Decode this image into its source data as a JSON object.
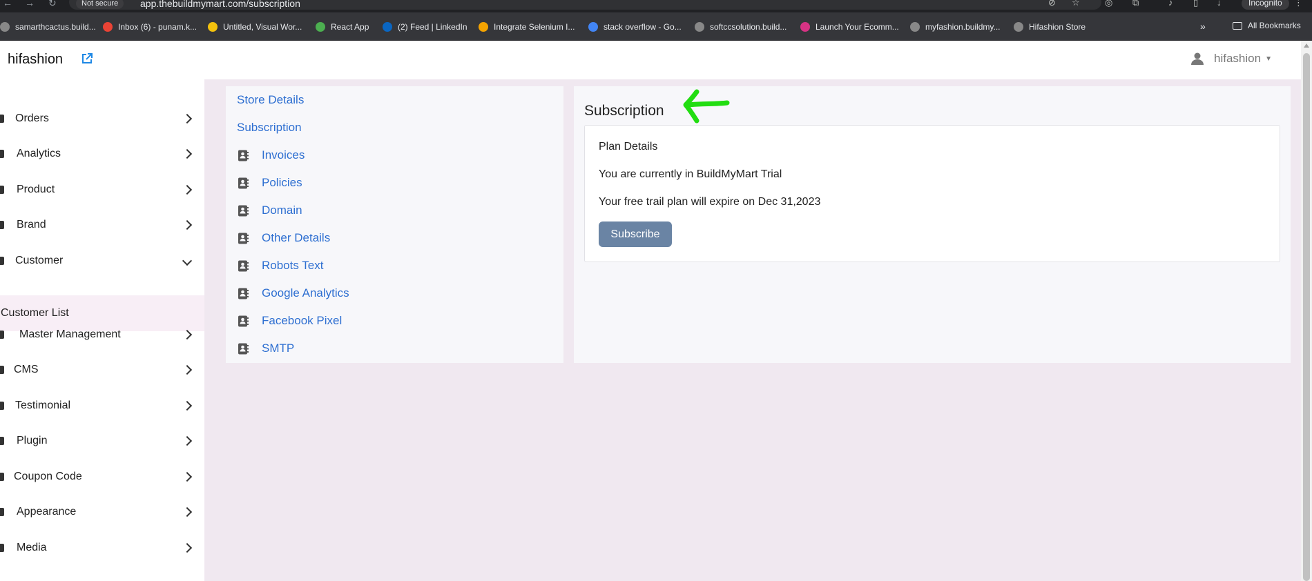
{
  "browser": {
    "not_secure": "Not secure",
    "url": "app.thebuildmymart.com/subscription",
    "profile": "Incognito",
    "bookmarks": [
      {
        "label": "samarthcactus.build...",
        "icon_color": "#888888"
      },
      {
        "label": "Inbox (6) - punam.k...",
        "icon_color": "#ea4335"
      },
      {
        "label": "Untitled, Visual Wor...",
        "icon_color": "#f4c20d"
      },
      {
        "label": "React App",
        "icon_color": "#4caf50"
      },
      {
        "label": "(2) Feed | LinkedIn",
        "icon_color": "#0a66c2"
      },
      {
        "label": "Integrate Selenium I...",
        "icon_color": "#f4a300"
      },
      {
        "label": "stack overflow - Go...",
        "icon_color": "#4285f4"
      },
      {
        "label": "softccsolution.build...",
        "icon_color": "#888888"
      },
      {
        "label": "Launch Your Ecomm...",
        "icon_color": "#d63384"
      },
      {
        "label": "myfashion.buildmy...",
        "icon_color": "#888888"
      },
      {
        "label": "Hifashion Store",
        "icon_color": "#888888"
      }
    ],
    "bookmarks_more": "»",
    "all_bookmarks": "All Bookmarks"
  },
  "header": {
    "brand": "hifashion",
    "user": "hifashion"
  },
  "sidebar": {
    "items": [
      {
        "label": "Orders",
        "expanded": false
      },
      {
        "label": "Analytics",
        "expanded": false
      },
      {
        "label": "Product",
        "expanded": false
      },
      {
        "label": "Brand",
        "expanded": false
      },
      {
        "label": "Customer",
        "expanded": true
      },
      {
        "label": "Master Management",
        "expanded": false
      },
      {
        "label": "CMS",
        "expanded": false
      },
      {
        "label": "Testimonial",
        "expanded": false
      },
      {
        "label": "Plugin",
        "expanded": false
      },
      {
        "label": "Coupon Code",
        "expanded": false
      },
      {
        "label": "Appearance",
        "expanded": false
      },
      {
        "label": "Media",
        "expanded": false
      }
    ],
    "sub_item": "Customer List"
  },
  "settings_nav": {
    "items": [
      {
        "label": "Store Details",
        "has_icon": false
      },
      {
        "label": "Subscription",
        "has_icon": false
      },
      {
        "label": "Invoices",
        "has_icon": true
      },
      {
        "label": "Policies",
        "has_icon": true
      },
      {
        "label": "Domain",
        "has_icon": true
      },
      {
        "label": "Other Details",
        "has_icon": true
      },
      {
        "label": "Robots Text",
        "has_icon": true
      },
      {
        "label": "Google Analytics",
        "has_icon": true
      },
      {
        "label": "Facebook Pixel",
        "has_icon": true
      },
      {
        "label": "SMTP",
        "has_icon": true
      }
    ]
  },
  "subscription": {
    "title": "Subscription",
    "plan_heading": "Plan Details",
    "current_plan": "You are currently in BuildMyMart Trial",
    "expiry": "Your free trail plan will expire on Dec 31,2023",
    "subscribe_label": "Subscribe"
  },
  "colors": {
    "link": "#2e6fd1",
    "button": "#6a84a4",
    "annotation_arrow": "#22dd11",
    "page_bg": "#f0e8f0"
  }
}
